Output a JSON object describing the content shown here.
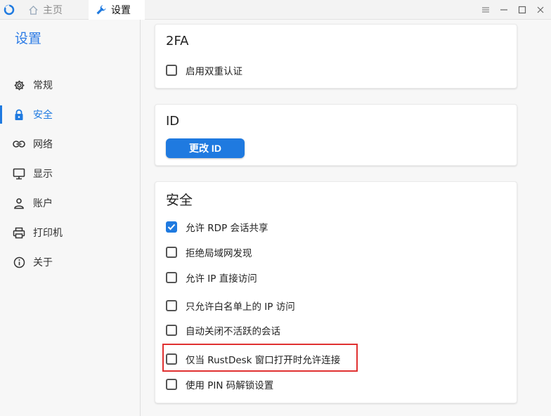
{
  "titlebar": {
    "tabs": [
      {
        "label": "主页",
        "icon": "home-icon"
      },
      {
        "label": "设置",
        "icon": "wrench-icon"
      }
    ],
    "controls": [
      "menu-icon",
      "minimize-icon",
      "maximize-icon",
      "close-icon"
    ]
  },
  "sidebar": {
    "title": "设置",
    "items": [
      {
        "label": "常规",
        "icon": "gear-icon"
      },
      {
        "label": "安全",
        "icon": "lock-icon",
        "active": true
      },
      {
        "label": "网络",
        "icon": "link-icon"
      },
      {
        "label": "显示",
        "icon": "monitor-icon"
      },
      {
        "label": "账户",
        "icon": "user-icon"
      },
      {
        "label": "打印机",
        "icon": "printer-icon"
      },
      {
        "label": "关于",
        "icon": "info-icon"
      }
    ]
  },
  "main": {
    "twofa": {
      "title": "2FA",
      "options": [
        {
          "label": "启用双重认证",
          "checked": false
        }
      ]
    },
    "id": {
      "title": "ID",
      "button_label": "更改 ID"
    },
    "security": {
      "title": "安全",
      "options": [
        {
          "label": "允许 RDP 会话共享",
          "checked": true
        },
        {
          "label": "拒绝局域网发现",
          "checked": false
        },
        {
          "label": "允许 IP 直接访问",
          "checked": false
        },
        {
          "label": "只允许白名单上的 IP 访问",
          "checked": false
        },
        {
          "label": "自动关闭不活跃的会话",
          "checked": false
        },
        {
          "label": "仅当 RustDesk 窗口打开时允许连接",
          "checked": false
        },
        {
          "label": "使用 PIN 码解锁设置",
          "checked": false
        }
      ]
    }
  },
  "colors": {
    "accent": "#1f7ae0",
    "highlight": "#e03131"
  }
}
